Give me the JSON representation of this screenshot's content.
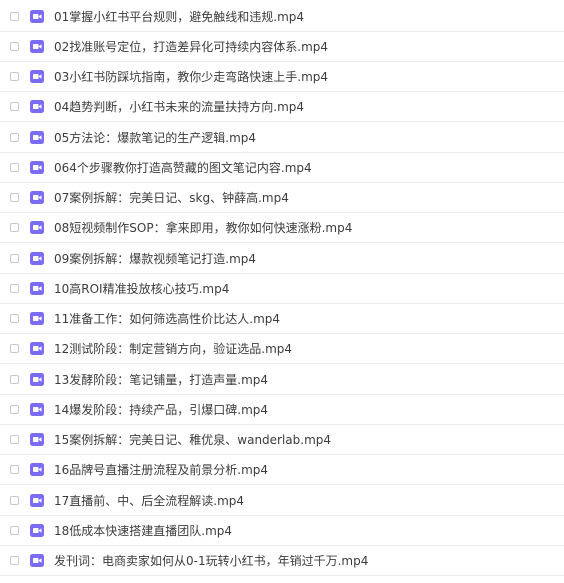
{
  "file_list": {
    "icon": "video-file-icon",
    "icon_color": "#7b6cf6",
    "items": [
      {
        "name": "01掌握小红书平台规则，避免触线和违规.mp4"
      },
      {
        "name": "02找准账号定位，打造差异化可持续内容体系.mp4"
      },
      {
        "name": "03小红书防踩坑指南，教你少走弯路快速上手.mp4"
      },
      {
        "name": "04趋势判断，小红书未来的流量扶持方向.mp4"
      },
      {
        "name": "05方法论：爆款笔记的生产逻辑.mp4"
      },
      {
        "name": "064个步骤教你打造高赞藏的图文笔记内容.mp4"
      },
      {
        "name": "07案例拆解：完美日记、skg、钟薛高.mp4"
      },
      {
        "name": "08短视频制作SOP：拿来即用，教你如何快速涨粉.mp4"
      },
      {
        "name": "09案例拆解：爆款视频笔记打造.mp4"
      },
      {
        "name": "10高ROI精准投放核心技巧.mp4"
      },
      {
        "name": "11准备工作：如何筛选高性价比达人.mp4"
      },
      {
        "name": "12测试阶段：制定营销方向，验证选品.mp4"
      },
      {
        "name": "13发酵阶段：笔记铺量，打造声量.mp4"
      },
      {
        "name": "14爆发阶段：持续产品，引爆口碑.mp4"
      },
      {
        "name": "15案例拆解：完美日记、稚优泉、wanderlab.mp4"
      },
      {
        "name": "16品牌号直播注册流程及前景分析.mp4"
      },
      {
        "name": "17直播前、中、后全流程解读.mp4"
      },
      {
        "name": "18低成本快速搭建直播团队.mp4"
      },
      {
        "name": "发刊词：电商卖家如何从0-1玩转小红书，年销过千万.mp4"
      }
    ]
  }
}
